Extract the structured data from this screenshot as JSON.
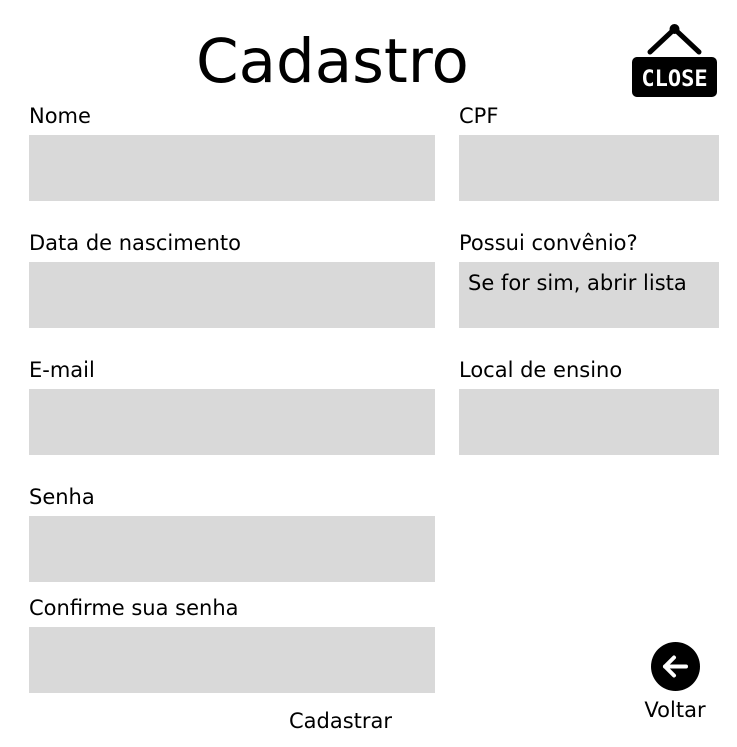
{
  "page": {
    "title": "Cadastro"
  },
  "close_button": {
    "label": "CLOSE",
    "icon": "hanging-close-sign-icon"
  },
  "form": {
    "nome": {
      "label": "Nome",
      "value": "",
      "placeholder": ""
    },
    "cpf": {
      "label": "CPF",
      "value": "",
      "placeholder": ""
    },
    "data_nascimento": {
      "label": "Data de nascimento",
      "value": "",
      "placeholder": ""
    },
    "convenio": {
      "label": "Possui convênio?",
      "value": "",
      "placeholder": "Se for sim, abrir lista"
    },
    "email": {
      "label": "E-mail",
      "value": "",
      "placeholder": ""
    },
    "local_ensino": {
      "label": "Local de ensino",
      "value": "",
      "placeholder": ""
    },
    "senha": {
      "label": "Senha",
      "value": "",
      "placeholder": ""
    },
    "confirme_senha": {
      "label": "Confirme sua senha",
      "value": "",
      "placeholder": ""
    },
    "submit_label": "Cadastrar"
  },
  "back_button": {
    "label": "Voltar",
    "icon": "arrow-left-icon"
  },
  "colors": {
    "field_background": "#d9d9d9",
    "text": "#000000",
    "background": "#ffffff"
  }
}
